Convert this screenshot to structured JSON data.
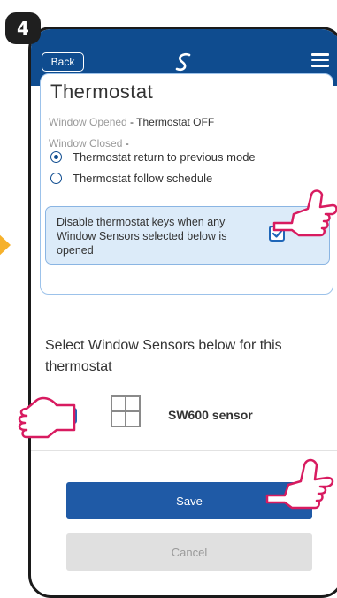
{
  "step": {
    "number": "4"
  },
  "header": {
    "back_label": "Back",
    "logo_icon": "salus-logo-icon",
    "menu_icon": "hamburger-menu-icon",
    "color": "#0f4c8f"
  },
  "thermostat_card": {
    "title": "Thermostat",
    "window_opened_label": "Window Opened",
    "window_opened_value": " - Thermostat OFF",
    "window_closed_label": "Window Closed",
    "window_closed_suffix": " -",
    "options": [
      {
        "label": "Thermostat return to previous mode",
        "selected": true
      },
      {
        "label": "Thermostat follow schedule",
        "selected": false
      }
    ],
    "disable_keys": {
      "text": "Disable thermostat keys when any Window Sensors selected below is opened",
      "checked": true
    }
  },
  "sensors": {
    "heading": "Select Window Sensors below for this thermostat",
    "items": [
      {
        "name": "SW600 sensor",
        "checked": true,
        "icon": "window-icon"
      }
    ]
  },
  "actions": {
    "save_label": "Save",
    "cancel_label": "Cancel"
  },
  "colors": {
    "accent": "#1f5aa6",
    "badge": "#1f1f1f",
    "arrow": "#f6b12b",
    "hand_outline": "#d81b60"
  }
}
